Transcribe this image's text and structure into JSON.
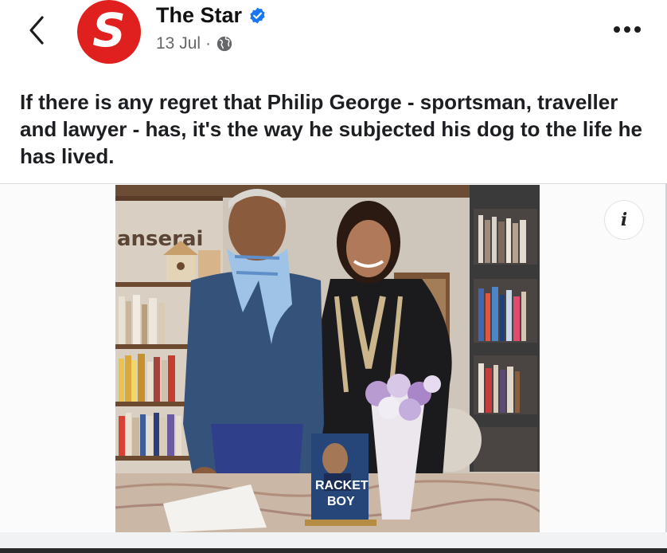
{
  "header": {
    "avatar_letter": "S",
    "page_name": "The Star",
    "date": "13 Jul",
    "separator": "·",
    "brand_color": "#e0201e",
    "verified_color": "#1877f2"
  },
  "post": {
    "caption": "If there is any regret that Philip George - sportsman, traveller and lawyer - has, it's the way he subjected his dog to the life he has lived."
  },
  "photo": {
    "store_sign": "anserai",
    "book_title_line1": "RACKET",
    "book_title_line2": "BOY"
  },
  "icons": {
    "back": "chevron-left-icon",
    "verified": "verified-badge-icon",
    "audience": "globe-icon",
    "more": "more-options-icon",
    "info": "info-icon"
  }
}
